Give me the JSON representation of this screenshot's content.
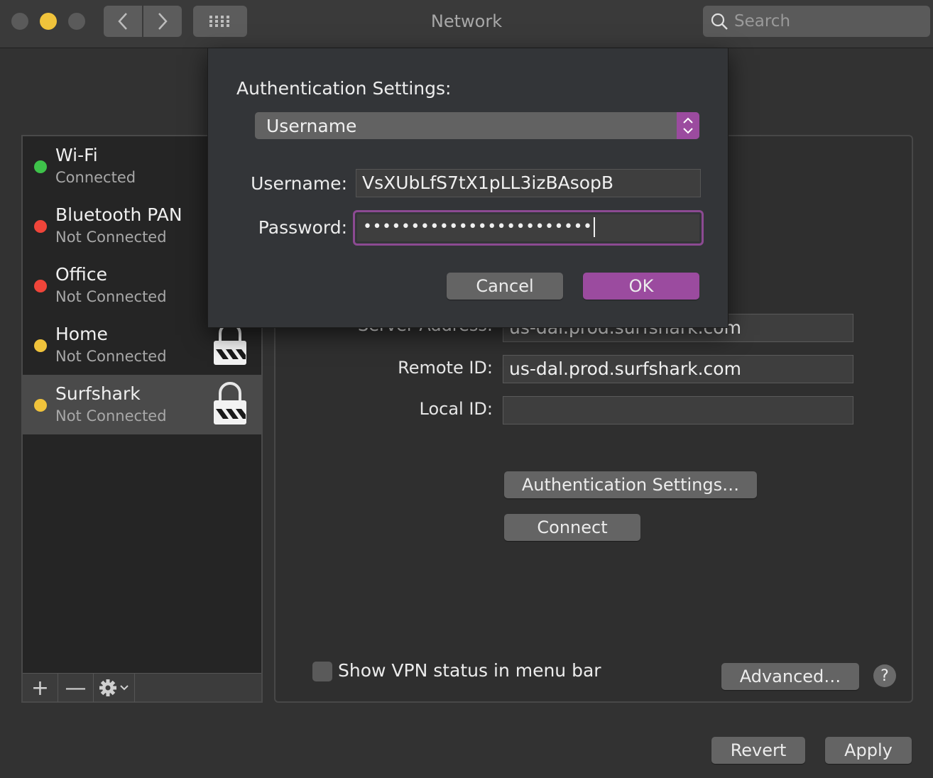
{
  "window": {
    "title": "Network"
  },
  "search": {
    "placeholder": "Search"
  },
  "colors": {
    "accent": "#9b4b9f",
    "green": "#3ec24a",
    "red": "#f0453a",
    "yellow": "#f0c33b"
  },
  "services": [
    {
      "name": "Wi-Fi",
      "status": "Connected",
      "dot": "#3ec24a",
      "locked": false,
      "selected": false
    },
    {
      "name": "Bluetooth PAN",
      "status": "Not Connected",
      "dot": "#f0453a",
      "locked": false,
      "selected": false
    },
    {
      "name": "Office",
      "status": "Not Connected",
      "dot": "#f0453a",
      "locked": false,
      "selected": false
    },
    {
      "name": "Home",
      "status": "Not Connected",
      "dot": "#f0c33b",
      "locked": true,
      "selected": false
    },
    {
      "name": "Surfshark",
      "status": "Not Connected",
      "dot": "#f0c33b",
      "locked": true,
      "selected": true
    }
  ],
  "sidebar_toolbar": {
    "add": "+",
    "remove": "—"
  },
  "vpn": {
    "server_address_label": "Server Address:",
    "server_address": "us-dal.prod.surfshark.com",
    "remote_id_label": "Remote ID:",
    "remote_id": "us-dal.prod.surfshark.com",
    "local_id_label": "Local ID:",
    "local_id": "",
    "auth_button": "Authentication Settings…",
    "connect_button": "Connect",
    "show_status_label": "Show VPN status in menu bar",
    "advanced_button": "Advanced…",
    "help": "?"
  },
  "footer": {
    "revert": "Revert",
    "apply": "Apply"
  },
  "sheet": {
    "title": "Authentication Settings:",
    "method": "Username",
    "username_label": "Username:",
    "username": "VsXUbLfS7tX1pLL3izBAsopB",
    "password_label": "Password:",
    "password_masked": "••••••••••••••••••••••••",
    "cancel": "Cancel",
    "ok": "OK"
  }
}
